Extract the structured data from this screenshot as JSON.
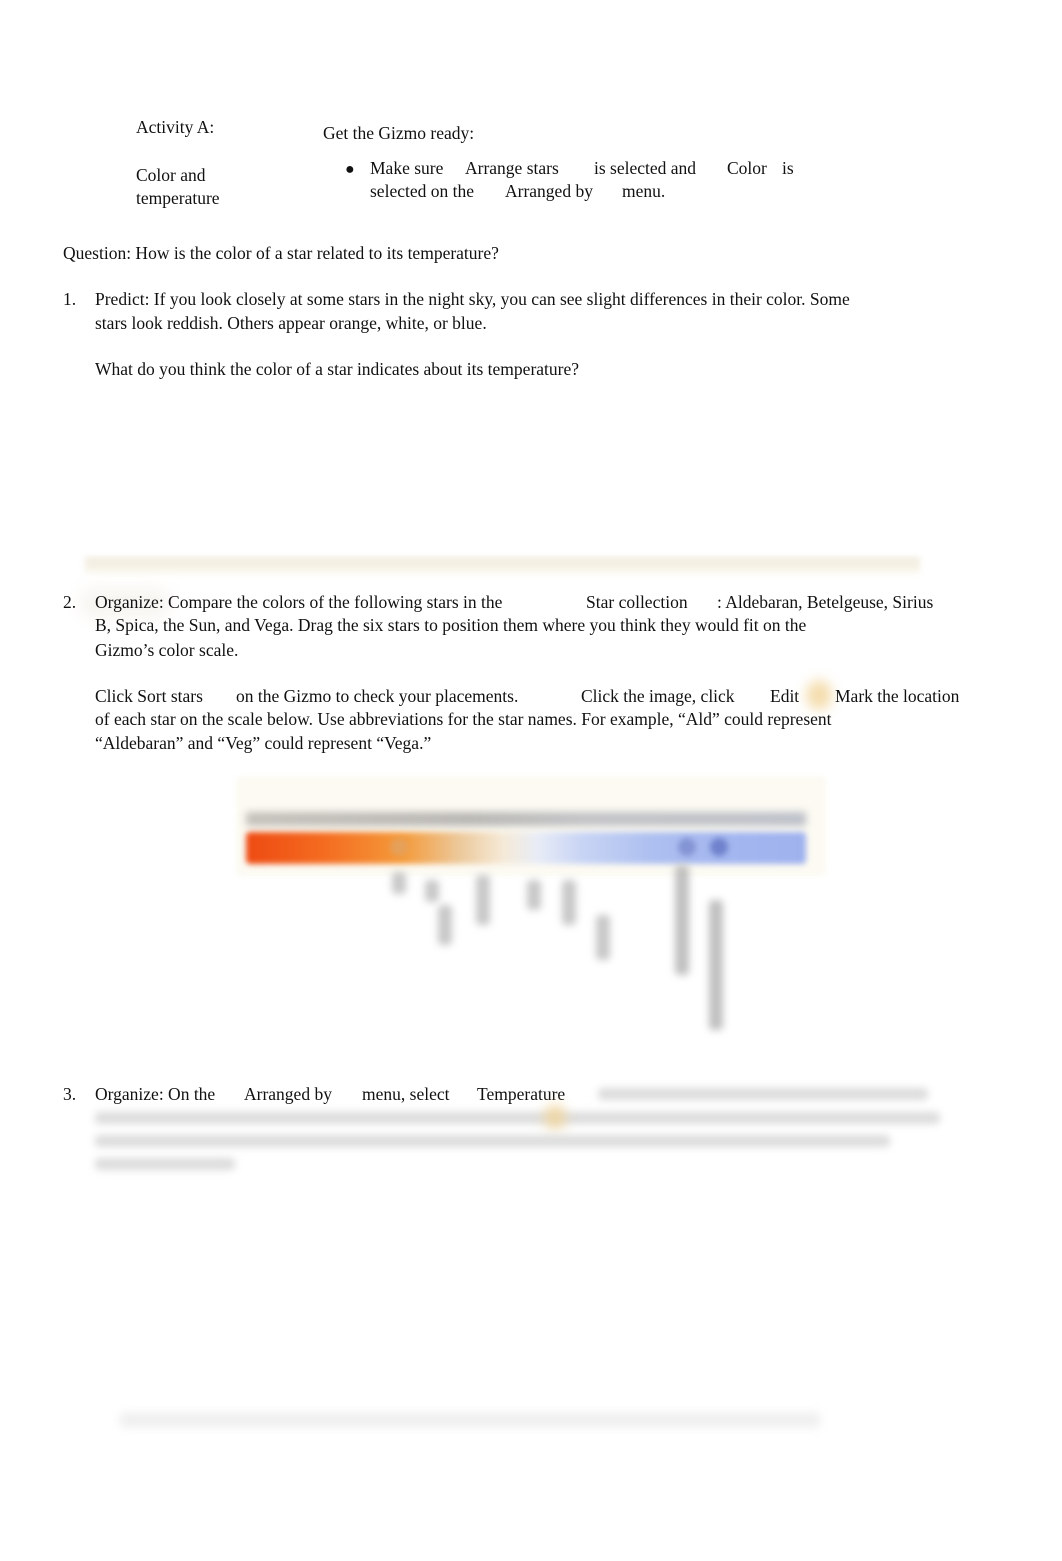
{
  "activity": {
    "label": "Activity A:",
    "title_line1": "Color and",
    "title_line2": "temperature"
  },
  "setup": {
    "heading": "Get the Gizmo ready:",
    "bullet": {
      "part1": "Make sure",
      "arrange_stars": "Arrange stars",
      "part2": "is selected and",
      "color": "Color",
      "part3": "is",
      "part4": "selected on the",
      "arranged_by": "Arranged by",
      "part5": "menu."
    }
  },
  "question": "Question: How is the color of a star related to its temperature?",
  "items": [
    {
      "number": "1.",
      "lines": [
        "Predict: If you look closely at some stars in the night sky, you can see slight differences in their color. Some",
        "stars look reddish. Others appear orange, white, or blue."
      ],
      "prompt": "What do you think the color of a star indicates about its temperature?"
    },
    {
      "number": "2.",
      "line1_a": "Organize: Compare the colors of the following stars in the",
      "line1_b": "Star collection",
      "line1_c": ": Aldebaran, Betelgeuse, Sirius",
      "line2": "B, Spica, the Sun, and Vega. Drag the six stars to position them where you think they would fit on the",
      "line3": "Gizmo’s color scale.",
      "para2_a": "Click Sort stars",
      "para2_b": "on the Gizmo to check your placements.",
      "para2_c": "Click  the image, click",
      "para2_d": "Edit",
      "para2_e": "Mark the location",
      "para2_line2": "of each star on the scale below. Use abbreviations for the star names. For example, “Ald” could represent",
      "para2_line3": "“Aldebaran” and “Veg” could represent “Vega.”"
    },
    {
      "number": "3.",
      "part_a": "Organize: On the",
      "part_b": "Arranged by",
      "part_c": "menu, select",
      "part_d": "Temperature"
    }
  ],
  "icons": {
    "bullet": "●"
  },
  "colors": {
    "text": "#111111",
    "scale_red": "#ee4a12",
    "scale_orange": "#f49a3a",
    "scale_white": "#f5ead8",
    "scale_blue": "#9fb2ee"
  }
}
